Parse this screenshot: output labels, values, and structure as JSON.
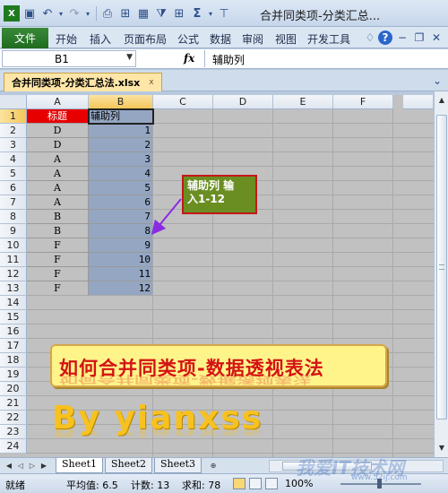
{
  "window": {
    "title": "合并同类项-分类汇总..."
  },
  "ribbon": {
    "file_tab": "文件",
    "tabs": [
      "开始",
      "插入",
      "页面布局",
      "公式",
      "数据",
      "审阅",
      "视图",
      "开发工具"
    ]
  },
  "formula_bar": {
    "name_box": "B1",
    "fx_label": "fx",
    "content": "辅助列"
  },
  "workbook_tab": {
    "label": "合并同类项-分类汇总法.xlsx",
    "close": "x"
  },
  "grid": {
    "columns": [
      "A",
      "B",
      "C",
      "D",
      "E",
      "F"
    ],
    "row_numbers": [
      "1",
      "2",
      "3",
      "4",
      "5",
      "6",
      "7",
      "8",
      "9",
      "10",
      "11",
      "12",
      "13",
      "14",
      "15",
      "16",
      "17",
      "18",
      "19",
      "20",
      "21",
      "22",
      "23",
      "24"
    ],
    "header_row": {
      "a": "标题",
      "b": "辅助列"
    },
    "rows": [
      {
        "a": "D",
        "b": "1"
      },
      {
        "a": "D",
        "b": "2"
      },
      {
        "a": "A",
        "b": "3"
      },
      {
        "a": "A",
        "b": "4"
      },
      {
        "a": "A",
        "b": "5"
      },
      {
        "a": "A",
        "b": "6"
      },
      {
        "a": "B",
        "b": "7"
      },
      {
        "a": "B",
        "b": "8"
      },
      {
        "a": "F",
        "b": "9"
      },
      {
        "a": "F",
        "b": "10"
      },
      {
        "a": "F",
        "b": "11"
      },
      {
        "a": "F",
        "b": "12"
      }
    ],
    "selected_cell": "B1"
  },
  "callout": {
    "text": "辅助列 输\n入1-12"
  },
  "art": {
    "banner": "如何合并同类项-数据透视表法",
    "byline": "By yianxss"
  },
  "sheets": {
    "tabs": [
      "Sheet1",
      "Sheet2",
      "Sheet3"
    ],
    "active": "Sheet1"
  },
  "status": {
    "mode": "就绪",
    "average": "平均值: 6.5",
    "count": "计数: 13",
    "sum": "求和: 78",
    "zoom": "100%"
  },
  "watermark": {
    "text": "我爱IT技术网",
    "sub": "www.52ij.com"
  }
}
